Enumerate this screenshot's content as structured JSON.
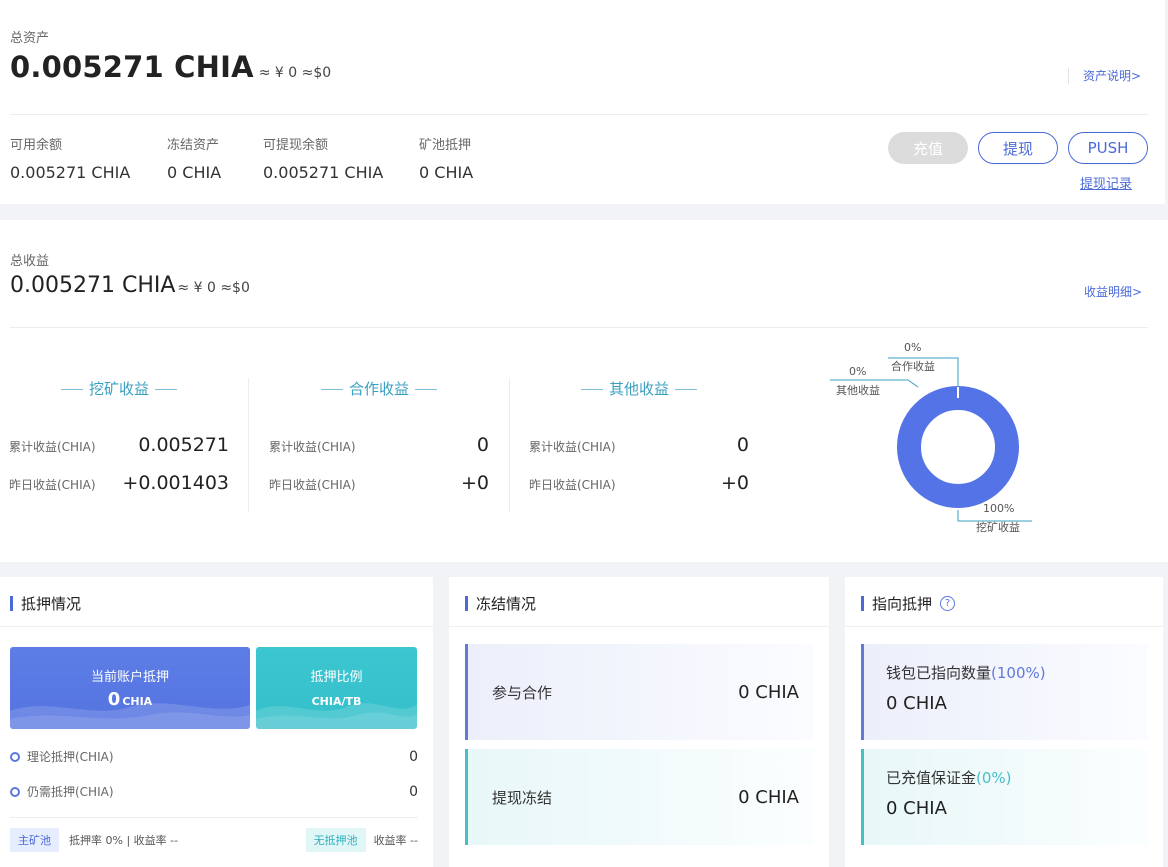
{
  "asset": {
    "title": "总资产",
    "total": "0.005271 CHIA",
    "approx": "≈ ¥ 0 ≈$0",
    "explain_link": "资产说明>",
    "stats": [
      {
        "label": "可用余额",
        "value": "0.005271 CHIA"
      },
      {
        "label": "冻结资产",
        "value": "0 CHIA"
      },
      {
        "label": "可提现余额",
        "value": "0.005271 CHIA"
      },
      {
        "label": "矿池抵押",
        "value": "0 CHIA"
      }
    ],
    "buttons": {
      "recharge": "充值",
      "withdraw": "提现",
      "push": "PUSH"
    },
    "withdraw_record": "提现记录"
  },
  "income": {
    "title": "总收益",
    "total": "0.005271 CHIA",
    "approx": "≈ ¥ 0 ≈$0",
    "detail_link": "收益明细>",
    "columns": [
      {
        "title": "挖矿收益",
        "rows": [
          {
            "label": "累计收益(CHIA)",
            "value": "0.005271"
          },
          {
            "label": "昨日收益(CHIA)",
            "value": "+0.001403"
          }
        ]
      },
      {
        "title": "合作收益",
        "rows": [
          {
            "label": "累计收益(CHIA)",
            "value": "0"
          },
          {
            "label": "昨日收益(CHIA)",
            "value": "+0"
          }
        ]
      },
      {
        "title": "其他收益",
        "rows": [
          {
            "label": "累计收益(CHIA)",
            "value": "0"
          },
          {
            "label": "昨日收益(CHIA)",
            "value": "+0"
          }
        ]
      }
    ],
    "donut": {
      "color": "#5473e6",
      "slices": [
        {
          "name": "挖矿收益",
          "percent": "100%",
          "value": 100
        },
        {
          "name": "合作收益",
          "percent": "0%",
          "value": 0
        },
        {
          "name": "其他收益",
          "percent": "0%",
          "value": 0
        }
      ]
    }
  },
  "pledge": {
    "title": "抵押情况",
    "tile_current": {
      "label": "当前账户抵押",
      "value": "0",
      "unit": "CHIA"
    },
    "tile_ratio": {
      "label": "抵押比例",
      "unit": "CHIA/TB"
    },
    "rows": [
      {
        "label": "理论抵押(CHIA)",
        "value": "0"
      },
      {
        "label": "仍需抵押(CHIA)",
        "value": "0"
      }
    ],
    "footer": {
      "main_tag": "主矿池",
      "main_text": "抵押率 0% | 收益率 --",
      "none_tag": "无抵押池",
      "none_text": "收益率 --"
    }
  },
  "freeze": {
    "title": "冻结情况",
    "items": [
      {
        "label": "参与合作",
        "value": "0 CHIA"
      },
      {
        "label": "提现冻结",
        "value": "0 CHIA"
      }
    ]
  },
  "point": {
    "title": "指向抵押",
    "help": "?",
    "items": [
      {
        "label": "钱包已指向数量",
        "pct": "(100%)",
        "value": "0 CHIA"
      },
      {
        "label": "已充值保证金",
        "pct": "(0%)",
        "value": "0 CHIA"
      }
    ]
  }
}
